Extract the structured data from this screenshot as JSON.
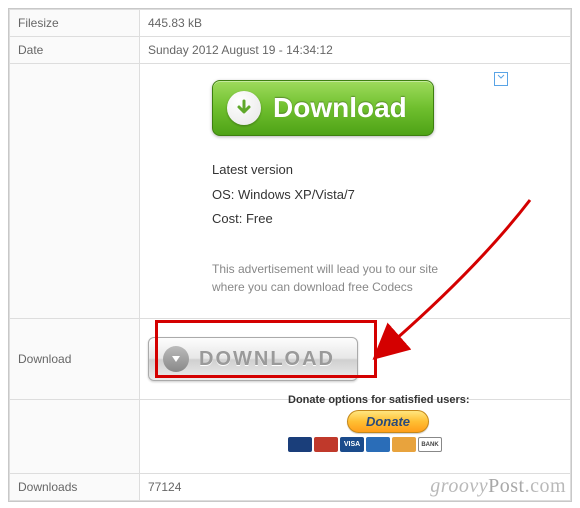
{
  "rows": {
    "filesize": {
      "label": "Filesize",
      "value": "445.83 kB"
    },
    "date": {
      "label": "Date",
      "value": "Sunday 2012 August 19 - 14:34:12"
    },
    "download": {
      "label": "Download"
    },
    "downloads": {
      "label": "Downloads",
      "value": "77124"
    }
  },
  "ad": {
    "button": "Download",
    "line1": "Latest version",
    "line2": "OS: Windows XP/Vista/7",
    "line3": "Cost: Free",
    "footer1": "This advertisement will lead you to our site",
    "footer2": "where you can download free Codecs"
  },
  "silver": {
    "label": "DOWNLOAD"
  },
  "donate": {
    "text": "Donate options for satisfied users:",
    "button": "Donate"
  },
  "watermark": {
    "g": "groovy",
    "p": "Post",
    "c": ".com"
  }
}
